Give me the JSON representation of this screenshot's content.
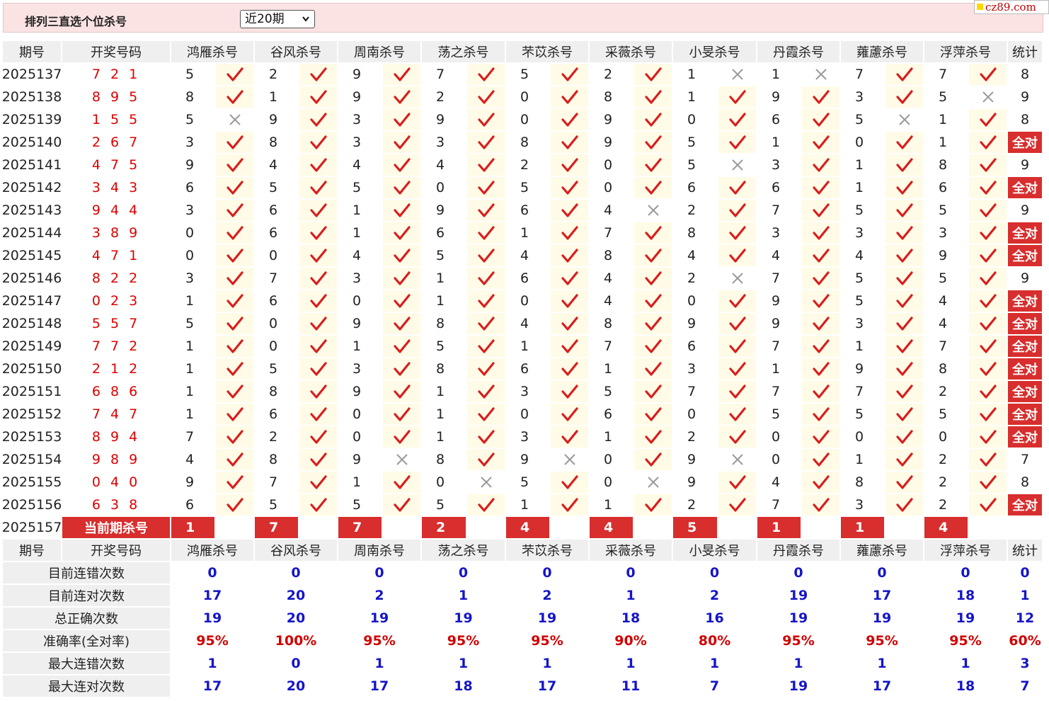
{
  "header": {
    "title": "排列三直选个位杀号",
    "period_select": "近20期",
    "site": "cz89.com"
  },
  "colors": {
    "check": "#d81e1e",
    "cross": "#9a9a9a",
    "accent_red": "#d82e2e",
    "stat_blue": "#1515c8"
  },
  "table": {
    "headers": [
      "期号",
      "开奖号码",
      "鸿雁杀号",
      "谷风杀号",
      "周南杀号",
      "荡之杀号",
      "芣苡杀号",
      "采薇杀号",
      "小旻杀号",
      "丹霞杀号",
      "蕹藘杀号",
      "浮萍杀号",
      "统计"
    ],
    "rows": [
      {
        "issue": "2025137",
        "draw": "7 2 1",
        "kills": [
          [
            "5",
            true
          ],
          [
            "2",
            true
          ],
          [
            "9",
            true
          ],
          [
            "7",
            true
          ],
          [
            "5",
            true
          ],
          [
            "2",
            true
          ],
          [
            "1",
            false
          ],
          [
            "1",
            false
          ],
          [
            "7",
            true
          ],
          [
            "7",
            true
          ]
        ],
        "count": "8"
      },
      {
        "issue": "2025138",
        "draw": "8 9 5",
        "kills": [
          [
            "8",
            true
          ],
          [
            "1",
            true
          ],
          [
            "9",
            true
          ],
          [
            "2",
            true
          ],
          [
            "0",
            true
          ],
          [
            "8",
            true
          ],
          [
            "1",
            true
          ],
          [
            "9",
            true
          ],
          [
            "3",
            true
          ],
          [
            "5",
            false
          ]
        ],
        "count": "9"
      },
      {
        "issue": "2025139",
        "draw": "1 5 5",
        "kills": [
          [
            "5",
            false
          ],
          [
            "9",
            true
          ],
          [
            "3",
            true
          ],
          [
            "9",
            true
          ],
          [
            "0",
            true
          ],
          [
            "9",
            true
          ],
          [
            "0",
            true
          ],
          [
            "6",
            true
          ],
          [
            "5",
            false
          ],
          [
            "1",
            true
          ]
        ],
        "count": "8"
      },
      {
        "issue": "2025140",
        "draw": "2 6 7",
        "kills": [
          [
            "3",
            true
          ],
          [
            "8",
            true
          ],
          [
            "3",
            true
          ],
          [
            "3",
            true
          ],
          [
            "8",
            true
          ],
          [
            "9",
            true
          ],
          [
            "5",
            true
          ],
          [
            "1",
            true
          ],
          [
            "0",
            true
          ],
          [
            "1",
            true
          ]
        ],
        "count": "全对"
      },
      {
        "issue": "2025141",
        "draw": "4 7 5",
        "kills": [
          [
            "9",
            true
          ],
          [
            "4",
            true
          ],
          [
            "4",
            true
          ],
          [
            "4",
            true
          ],
          [
            "2",
            true
          ],
          [
            "0",
            true
          ],
          [
            "5",
            false
          ],
          [
            "3",
            true
          ],
          [
            "1",
            true
          ],
          [
            "8",
            true
          ]
        ],
        "count": "9"
      },
      {
        "issue": "2025142",
        "draw": "3 4 3",
        "kills": [
          [
            "6",
            true
          ],
          [
            "5",
            true
          ],
          [
            "5",
            true
          ],
          [
            "0",
            true
          ],
          [
            "5",
            true
          ],
          [
            "0",
            true
          ],
          [
            "6",
            true
          ],
          [
            "6",
            true
          ],
          [
            "1",
            true
          ],
          [
            "6",
            true
          ]
        ],
        "count": "全对"
      },
      {
        "issue": "2025143",
        "draw": "9 4 4",
        "kills": [
          [
            "3",
            true
          ],
          [
            "6",
            true
          ],
          [
            "1",
            true
          ],
          [
            "9",
            true
          ],
          [
            "6",
            true
          ],
          [
            "4",
            false
          ],
          [
            "2",
            true
          ],
          [
            "7",
            true
          ],
          [
            "5",
            true
          ],
          [
            "5",
            true
          ]
        ],
        "count": "9"
      },
      {
        "issue": "2025144",
        "draw": "3 8 9",
        "kills": [
          [
            "0",
            true
          ],
          [
            "6",
            true
          ],
          [
            "1",
            true
          ],
          [
            "6",
            true
          ],
          [
            "1",
            true
          ],
          [
            "7",
            true
          ],
          [
            "8",
            true
          ],
          [
            "3",
            true
          ],
          [
            "3",
            true
          ],
          [
            "3",
            true
          ]
        ],
        "count": "全对"
      },
      {
        "issue": "2025145",
        "draw": "4 7 1",
        "kills": [
          [
            "0",
            true
          ],
          [
            "0",
            true
          ],
          [
            "4",
            true
          ],
          [
            "5",
            true
          ],
          [
            "4",
            true
          ],
          [
            "8",
            true
          ],
          [
            "4",
            true
          ],
          [
            "4",
            true
          ],
          [
            "4",
            true
          ],
          [
            "9",
            true
          ]
        ],
        "count": "全对"
      },
      {
        "issue": "2025146",
        "draw": "8 2 2",
        "kills": [
          [
            "3",
            true
          ],
          [
            "7",
            true
          ],
          [
            "3",
            true
          ],
          [
            "1",
            true
          ],
          [
            "6",
            true
          ],
          [
            "4",
            true
          ],
          [
            "2",
            false
          ],
          [
            "7",
            true
          ],
          [
            "5",
            true
          ],
          [
            "5",
            true
          ]
        ],
        "count": "9"
      },
      {
        "issue": "2025147",
        "draw": "0 2 3",
        "kills": [
          [
            "1",
            true
          ],
          [
            "6",
            true
          ],
          [
            "0",
            true
          ],
          [
            "1",
            true
          ],
          [
            "0",
            true
          ],
          [
            "4",
            true
          ],
          [
            "0",
            true
          ],
          [
            "9",
            true
          ],
          [
            "5",
            true
          ],
          [
            "4",
            true
          ]
        ],
        "count": "全对"
      },
      {
        "issue": "2025148",
        "draw": "5 5 7",
        "kills": [
          [
            "5",
            true
          ],
          [
            "0",
            true
          ],
          [
            "9",
            true
          ],
          [
            "8",
            true
          ],
          [
            "4",
            true
          ],
          [
            "8",
            true
          ],
          [
            "9",
            true
          ],
          [
            "9",
            true
          ],
          [
            "3",
            true
          ],
          [
            "4",
            true
          ]
        ],
        "count": "全对"
      },
      {
        "issue": "2025149",
        "draw": "7 7 2",
        "kills": [
          [
            "1",
            true
          ],
          [
            "0",
            true
          ],
          [
            "1",
            true
          ],
          [
            "5",
            true
          ],
          [
            "1",
            true
          ],
          [
            "7",
            true
          ],
          [
            "6",
            true
          ],
          [
            "7",
            true
          ],
          [
            "1",
            true
          ],
          [
            "7",
            true
          ]
        ],
        "count": "全对"
      },
      {
        "issue": "2025150",
        "draw": "2 1 2",
        "kills": [
          [
            "1",
            true
          ],
          [
            "5",
            true
          ],
          [
            "3",
            true
          ],
          [
            "8",
            true
          ],
          [
            "6",
            true
          ],
          [
            "1",
            true
          ],
          [
            "3",
            true
          ],
          [
            "1",
            true
          ],
          [
            "9",
            true
          ],
          [
            "8",
            true
          ]
        ],
        "count": "全对"
      },
      {
        "issue": "2025151",
        "draw": "6 8 6",
        "kills": [
          [
            "1",
            true
          ],
          [
            "8",
            true
          ],
          [
            "9",
            true
          ],
          [
            "1",
            true
          ],
          [
            "3",
            true
          ],
          [
            "5",
            true
          ],
          [
            "7",
            true
          ],
          [
            "7",
            true
          ],
          [
            "7",
            true
          ],
          [
            "2",
            true
          ]
        ],
        "count": "全对"
      },
      {
        "issue": "2025152",
        "draw": "7 4 7",
        "kills": [
          [
            "1",
            true
          ],
          [
            "6",
            true
          ],
          [
            "0",
            true
          ],
          [
            "1",
            true
          ],
          [
            "0",
            true
          ],
          [
            "6",
            true
          ],
          [
            "0",
            true
          ],
          [
            "5",
            true
          ],
          [
            "5",
            true
          ],
          [
            "5",
            true
          ]
        ],
        "count": "全对"
      },
      {
        "issue": "2025153",
        "draw": "8 9 4",
        "kills": [
          [
            "7",
            true
          ],
          [
            "2",
            true
          ],
          [
            "0",
            true
          ],
          [
            "1",
            true
          ],
          [
            "3",
            true
          ],
          [
            "1",
            true
          ],
          [
            "2",
            true
          ],
          [
            "0",
            true
          ],
          [
            "0",
            true
          ],
          [
            "0",
            true
          ]
        ],
        "count": "全对"
      },
      {
        "issue": "2025154",
        "draw": "9 8 9",
        "kills": [
          [
            "4",
            true
          ],
          [
            "8",
            true
          ],
          [
            "9",
            false
          ],
          [
            "8",
            true
          ],
          [
            "9",
            false
          ],
          [
            "0",
            true
          ],
          [
            "9",
            false
          ],
          [
            "0",
            true
          ],
          [
            "1",
            true
          ],
          [
            "2",
            true
          ]
        ],
        "count": "7"
      },
      {
        "issue": "2025155",
        "draw": "0 4 0",
        "kills": [
          [
            "9",
            true
          ],
          [
            "7",
            true
          ],
          [
            "1",
            true
          ],
          [
            "0",
            false
          ],
          [
            "5",
            true
          ],
          [
            "0",
            false
          ],
          [
            "9",
            true
          ],
          [
            "4",
            true
          ],
          [
            "8",
            true
          ],
          [
            "2",
            true
          ]
        ],
        "count": "8"
      },
      {
        "issue": "2025156",
        "draw": "6 3 8",
        "kills": [
          [
            "6",
            true
          ],
          [
            "5",
            true
          ],
          [
            "5",
            true
          ],
          [
            "5",
            true
          ],
          [
            "1",
            true
          ],
          [
            "1",
            true
          ],
          [
            "2",
            true
          ],
          [
            "7",
            true
          ],
          [
            "3",
            true
          ],
          [
            "2",
            true
          ]
        ],
        "count": "全对"
      }
    ],
    "current": {
      "issue": "2025157",
      "label": "当前期杀号",
      "kills": [
        "1",
        "7",
        "7",
        "2",
        "4",
        "4",
        "5",
        "1",
        "1",
        "4"
      ]
    },
    "stats": [
      {
        "label": "目前连错次数",
        "values": [
          "0",
          "0",
          "0",
          "0",
          "0",
          "0",
          "0",
          "0",
          "0",
          "0",
          "0"
        ]
      },
      {
        "label": "目前连对次数",
        "values": [
          "17",
          "20",
          "2",
          "1",
          "2",
          "1",
          "2",
          "19",
          "17",
          "18",
          "1"
        ]
      },
      {
        "label": "总正确次数",
        "values": [
          "19",
          "20",
          "19",
          "19",
          "19",
          "18",
          "16",
          "19",
          "19",
          "19",
          "12"
        ]
      },
      {
        "label": "准确率(全对率)",
        "values": [
          "95%",
          "100%",
          "95%",
          "95%",
          "95%",
          "90%",
          "80%",
          "95%",
          "95%",
          "95%",
          "60%"
        ]
      },
      {
        "label": "最大连错次数",
        "values": [
          "1",
          "0",
          "1",
          "1",
          "1",
          "1",
          "1",
          "1",
          "1",
          "1",
          "3"
        ]
      },
      {
        "label": "最大连对次数",
        "values": [
          "17",
          "20",
          "17",
          "18",
          "17",
          "11",
          "7",
          "19",
          "17",
          "18",
          "7"
        ]
      }
    ]
  }
}
